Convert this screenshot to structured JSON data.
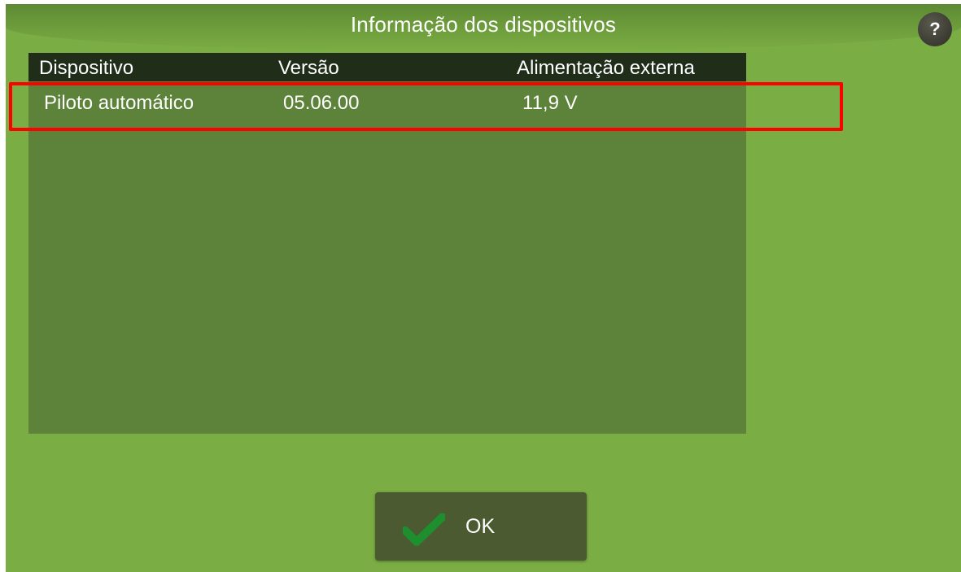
{
  "dialog": {
    "title": "Informação dos dispositivos",
    "help_label": "?"
  },
  "table": {
    "columns": [
      "Dispositivo",
      "Versão",
      "Alimentação externa"
    ],
    "rows": [
      [
        "Piloto automático",
        "05.06.00",
        "11,9 V"
      ]
    ]
  },
  "ok_button": {
    "label": "OK",
    "icon": "checkmark-icon"
  },
  "colors": {
    "background": "#7aad43",
    "table_background": "#5d8239",
    "header_background": "#1f2d19",
    "button_background": "#4b5a30",
    "checkmark": "#1e8f2e",
    "highlight": "#ff0000"
  }
}
